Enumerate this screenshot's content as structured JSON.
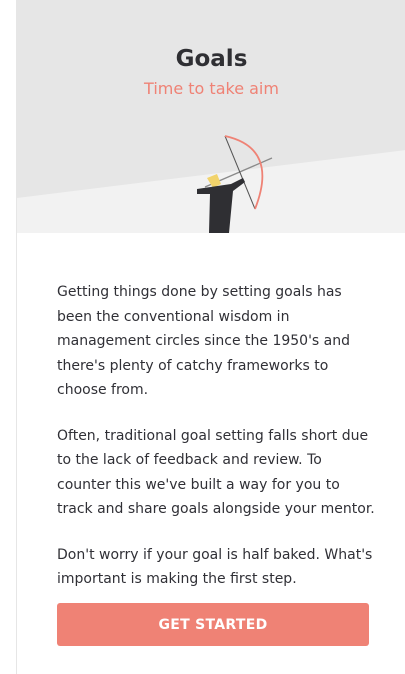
{
  "header": {
    "title": "Goals",
    "subtitle": "Time to take aim"
  },
  "illustration": {
    "icon": "archer-illustration",
    "accent_color": "#ef8275"
  },
  "body": {
    "paragraphs": [
      "Getting things done by setting goals has been the conventional wisdom in management circles since the 1950's and there's plenty of catchy frameworks to choose from.",
      "Often, traditional goal setting falls short due to the lack of feedback and review. To counter this we've built a way for you to track and share goals alongside your mentor.",
      "Don't worry if your goal is half baked. What's important is making the first step."
    ]
  },
  "actions": {
    "get_started_label": "GET STARTED"
  },
  "colors": {
    "accent": "#ef8275",
    "hero_background": "#e6e6e6",
    "text": "#303036"
  }
}
